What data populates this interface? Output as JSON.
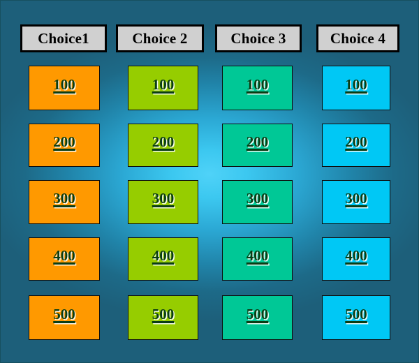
{
  "board": {
    "background_outer_color": "#1d5f7a",
    "background_center_color": "#3cc8f0",
    "columns": [
      {
        "header_label": "Choice1",
        "tile_color": "#ff9900",
        "values": [
          "100",
          "200",
          "300",
          "400",
          "500"
        ]
      },
      {
        "header_label": "Choice 2",
        "tile_color": "#96cd00",
        "values": [
          "100",
          "200",
          "300",
          "400",
          "500"
        ]
      },
      {
        "header_label": "Choice 3",
        "tile_color": "#00c896",
        "values": [
          "100",
          "200",
          "300",
          "400",
          "500"
        ]
      },
      {
        "header_label": "Choice 4",
        "tile_color": "#00c8f5",
        "values": [
          "100",
          "200",
          "300",
          "400",
          "500"
        ]
      }
    ],
    "header_background_color": "#d0d0d0",
    "header_border_color": "#000000",
    "tile_text_color": "#0a3d14"
  }
}
